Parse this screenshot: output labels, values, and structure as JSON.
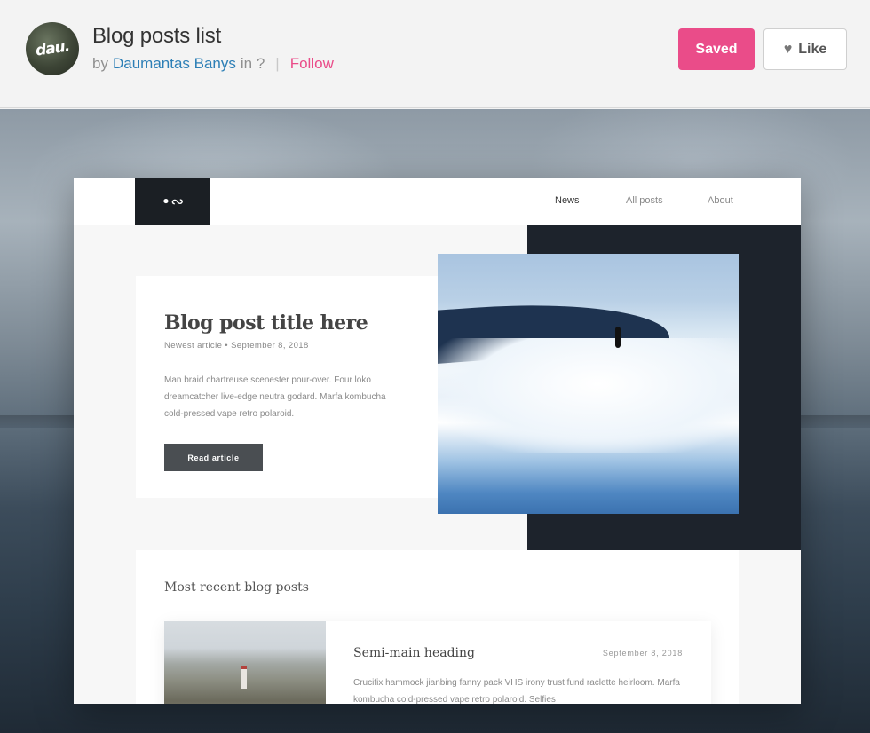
{
  "header": {
    "avatar_text": "dau.",
    "title": "Blog posts list",
    "by": "by",
    "author": "Daumantas Banys",
    "in": "in ?",
    "separator": "|",
    "follow": "Follow",
    "saved_label": "Saved",
    "like_label": "Like",
    "colors": {
      "accent": "#ea4c89",
      "author_link": "#2d7fb6"
    }
  },
  "mockup": {
    "logo": "•∾",
    "nav": [
      "News",
      "All posts",
      "About"
    ],
    "active_nav": "News",
    "hero": {
      "title": "Blog post title here",
      "meta": "Newest article • September 8, 2018",
      "text": "Man braid chartreuse scenester pour-over. Four loko dreamcatcher live-edge neutra godard. Marfa kombucha cold-pressed vape retro polaroid.",
      "button": "Read article"
    },
    "recent": {
      "heading": "Most recent blog posts",
      "post": {
        "title": "Semi-main heading",
        "date": "September 8, 2018",
        "text": "Crucifix hammock jianbing fanny pack VHS irony trust fund raclette heirloom. Marfa kombucha cold-pressed vape retro polaroid. Selfies"
      }
    }
  },
  "icons": {
    "like": "heart-icon"
  }
}
